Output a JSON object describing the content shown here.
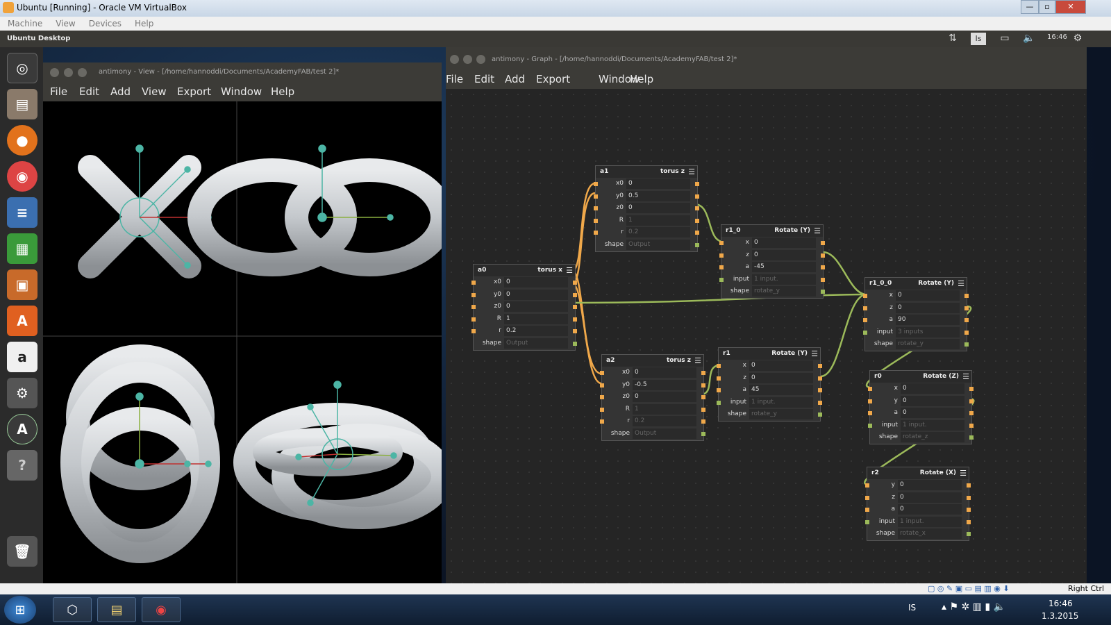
{
  "vbox": {
    "title": "Ubuntu [Running] - Oracle VM VirtualBox",
    "menu": [
      "Machine",
      "View",
      "Devices",
      "Help"
    ],
    "status_right": "Right Ctrl"
  },
  "ubuntu": {
    "desktop_label": "Ubuntu Desktop",
    "lang": "Is",
    "clock": "16:46"
  },
  "view_window": {
    "title": "antimony - View - [/home/hannoddi/Documents/AcademyFAB/test 2]*",
    "menu": [
      "File",
      "Edit",
      "Add",
      "View",
      "Export",
      "Window",
      "Help"
    ]
  },
  "graph_window": {
    "title": "antimony - Graph - [/home/hannoddi/Documents/AcademyFAB/test 2]*",
    "menu": [
      "File",
      "Edit",
      "Add",
      "Export",
      "Window",
      "Help"
    ]
  },
  "nodes": {
    "a1": {
      "name": "a1",
      "type": "torus z",
      "rows": [
        {
          "l": "x0",
          "v": "0"
        },
        {
          "l": "y0",
          "v": "0.5"
        },
        {
          "l": "z0",
          "v": "0"
        },
        {
          "l": "R",
          "v": "1",
          "dim": true
        },
        {
          "l": "r",
          "v": "0.2",
          "dim": true
        },
        {
          "l": "shape",
          "v": "Output",
          "dim": true
        }
      ]
    },
    "a0": {
      "name": "a0",
      "type": "torus x",
      "rows": [
        {
          "l": "x0",
          "v": "0"
        },
        {
          "l": "y0",
          "v": "0"
        },
        {
          "l": "z0",
          "v": "0"
        },
        {
          "l": "R",
          "v": "1"
        },
        {
          "l": "r",
          "v": "0.2"
        },
        {
          "l": "shape",
          "v": "Output",
          "dim": true
        }
      ]
    },
    "a2": {
      "name": "a2",
      "type": "torus z",
      "rows": [
        {
          "l": "x0",
          "v": "0"
        },
        {
          "l": "y0",
          "v": "-0.5"
        },
        {
          "l": "z0",
          "v": "0"
        },
        {
          "l": "R",
          "v": "1",
          "dim": true
        },
        {
          "l": "r",
          "v": "0.2",
          "dim": true
        },
        {
          "l": "shape",
          "v": "Output",
          "dim": true
        }
      ]
    },
    "r1_0": {
      "name": "r1_0",
      "type": "Rotate (Y)",
      "rows": [
        {
          "l": "x",
          "v": "0"
        },
        {
          "l": "z",
          "v": "0"
        },
        {
          "l": "a",
          "v": "-45"
        },
        {
          "l": "input",
          "v": "1 input.",
          "dim": true
        },
        {
          "l": "shape",
          "v": "rotate_y",
          "dim": true
        }
      ]
    },
    "r1": {
      "name": "r1",
      "type": "Rotate (Y)",
      "rows": [
        {
          "l": "x",
          "v": "0"
        },
        {
          "l": "z",
          "v": "0"
        },
        {
          "l": "a",
          "v": "45"
        },
        {
          "l": "input",
          "v": "1 input.",
          "dim": true
        },
        {
          "l": "shape",
          "v": "rotate_y",
          "dim": true
        }
      ]
    },
    "r1_0_0": {
      "name": "r1_0_0",
      "type": "Rotate (Y)",
      "rows": [
        {
          "l": "x",
          "v": "0"
        },
        {
          "l": "z",
          "v": "0"
        },
        {
          "l": "a",
          "v": "90"
        },
        {
          "l": "input",
          "v": "3 inputs",
          "dim": true
        },
        {
          "l": "shape",
          "v": "rotate_y",
          "dim": true
        }
      ]
    },
    "r0": {
      "name": "r0",
      "type": "Rotate (Z)",
      "rows": [
        {
          "l": "x",
          "v": "0"
        },
        {
          "l": "y",
          "v": "0"
        },
        {
          "l": "a",
          "v": "0"
        },
        {
          "l": "input",
          "v": "1 input.",
          "dim": true
        },
        {
          "l": "shape",
          "v": "rotate_z",
          "dim": true
        }
      ]
    },
    "r2": {
      "name": "r2",
      "type": "Rotate (X)",
      "rows": [
        {
          "l": "y",
          "v": "0"
        },
        {
          "l": "z",
          "v": "0"
        },
        {
          "l": "a",
          "v": "0"
        },
        {
          "l": "input",
          "v": "1 input.",
          "dim": true
        },
        {
          "l": "shape",
          "v": "rotate_x",
          "dim": true
        }
      ]
    }
  },
  "taskbar": {
    "lang": "IS",
    "time": "16:46",
    "date": "1.3.2015"
  }
}
